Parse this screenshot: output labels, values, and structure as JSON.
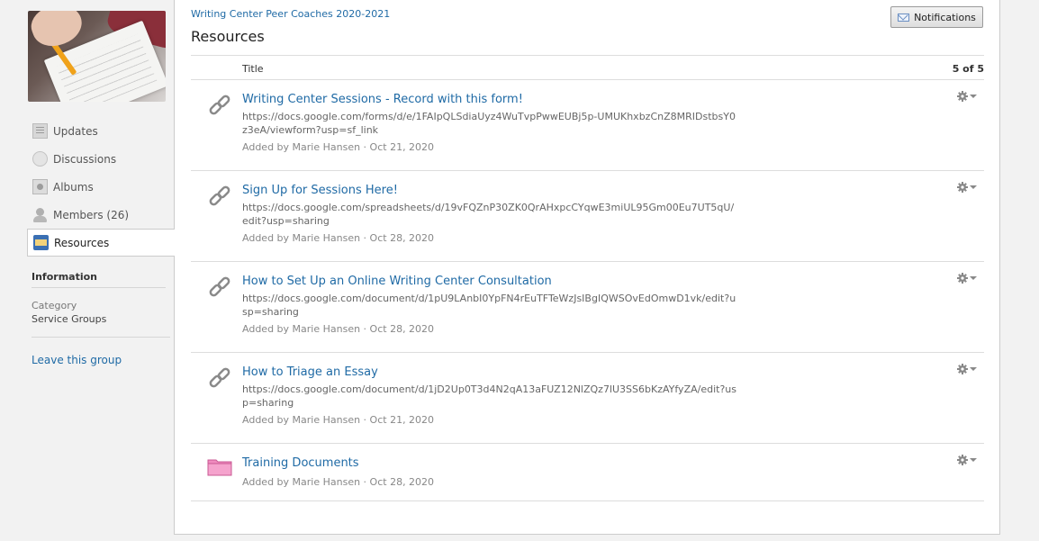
{
  "sidebar": {
    "nav": [
      {
        "label": "Updates",
        "icon": "updates-icon"
      },
      {
        "label": "Discussions",
        "icon": "discussions-icon"
      },
      {
        "label": "Albums",
        "icon": "albums-icon"
      },
      {
        "label": "Members (26)",
        "icon": "members-icon"
      },
      {
        "label": "Resources",
        "icon": "resources-icon",
        "active": true
      }
    ],
    "info_heading": "Information",
    "category_label": "Category",
    "category_value": "Service Groups",
    "leave_label": "Leave this group"
  },
  "header": {
    "breadcrumb": "Writing Center Peer Coaches 2020-2021",
    "title": "Resources",
    "notifications_label": "Notifications"
  },
  "table": {
    "col_title": "Title",
    "count": "5 of 5",
    "rows": [
      {
        "type": "link",
        "title": "Writing Center Sessions - Record with this form!",
        "url": "https://docs.google.com/forms/d/e/1FAIpQLSdiaUyz4WuTvpPwwEUBj5p-UMUKhxbzCnZ8MRIDstbsY0z3eA/viewform?usp=sf_link",
        "meta": "Added by Marie Hansen · Oct 21, 2020"
      },
      {
        "type": "link",
        "title": "Sign Up for Sessions Here!",
        "url": "https://docs.google.com/spreadsheets/d/19vFQZnP30ZK0QrAHxpcCYqwE3miUL95Gm00Eu7UT5qU/edit?usp=sharing",
        "meta": "Added by Marie Hansen · Oct 28, 2020"
      },
      {
        "type": "link",
        "title": "How to Set Up an Online Writing Center Consultation",
        "url": "https://docs.google.com/document/d/1pU9LAnbI0YpFN4rEuTFTeWzJsIBgIQWSOvEdOmwD1vk/edit?usp=sharing",
        "meta": "Added by Marie Hansen · Oct 28, 2020"
      },
      {
        "type": "link",
        "title": "How to Triage an Essay",
        "url": "https://docs.google.com/document/d/1jD2Up0T3d4N2qA13aFUZ12NlZQz7lU3SS6bKzAYfyZA/edit?usp=sharing",
        "meta": "Added by Marie Hansen · Oct 21, 2020"
      },
      {
        "type": "folder",
        "title": "Training Documents",
        "meta": "Added by Marie Hansen · Oct 28, 2020"
      }
    ]
  },
  "colors": {
    "link": "#1f6aa5",
    "folder": "#f08bbf",
    "border": "#cccccc",
    "background": "#f2f2f2"
  }
}
